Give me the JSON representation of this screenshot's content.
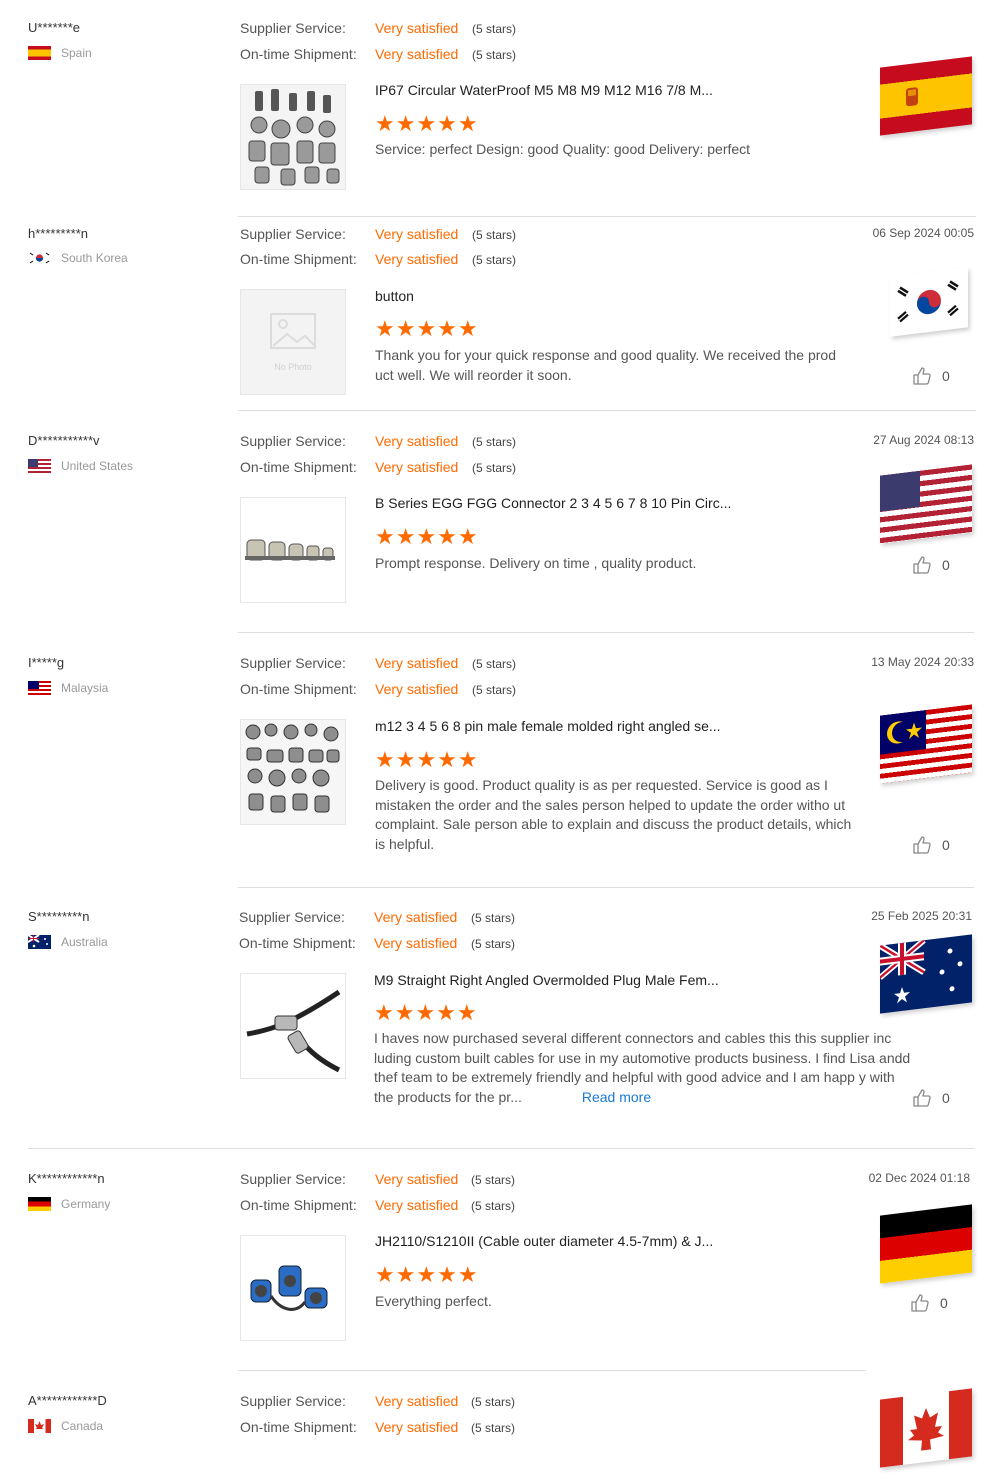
{
  "labels": {
    "supplier_service": "Supplier Service:",
    "ontime_shipment": "On-time Shipment:"
  },
  "colors": {
    "accent": "#ff6a00",
    "link": "#1a7ad0"
  },
  "reviews": [
    {
      "user": "U*******e",
      "country": "Spain",
      "date": "",
      "supplier_service": "Very satisfied",
      "supplier_stars": "(5 stars)",
      "shipment": "Very satisfied",
      "shipment_stars": "(5 stars)",
      "product_title": "IP67 Circular WaterProof M5 M8 M9 M12 M16 7/8 M...",
      "rating": 5,
      "content": "Service:   perfect Design:   good Quality:   good Delivery:   perfect",
      "likes": "",
      "flag": "spain"
    },
    {
      "user": "h*********n",
      "country": "South Korea",
      "date": "06 Sep 2024 00:05",
      "supplier_service": "Very satisfied",
      "supplier_stars": "(5 stars)",
      "shipment": "Very satisfied",
      "shipment_stars": "(5 stars)",
      "product_title": "button",
      "rating": 5,
      "content": "Thank you for your quick response and good quality. We received the prod uct well. We will reorder it soon.",
      "likes": "0",
      "flag": "korea",
      "placeholder_text": "No Photo"
    },
    {
      "user": "D***********v",
      "country": "United States",
      "date": "27 Aug 2024 08:13",
      "supplier_service": "Very satisfied",
      "supplier_stars": "(5 stars)",
      "shipment": "Very satisfied",
      "shipment_stars": "(5 stars)",
      "product_title": "B Series EGG FGG Connector 2 3 4 5 6 7 8 10 Pin Circ...",
      "rating": 5,
      "content": "Prompt response. Delivery on time , quality product.",
      "likes": "0",
      "flag": "usa"
    },
    {
      "user": "I*****g",
      "country": "Malaysia",
      "date": "13 May 2024 20:33",
      "supplier_service": "Very satisfied",
      "supplier_stars": "(5 stars)",
      "shipment": "Very satisfied",
      "shipment_stars": "(5 stars)",
      "product_title": "m12 3 4 5 6 8 pin male female molded right angled se...",
      "rating": 5,
      "content": "Delivery is good. Product quality is as per requested. Service is good as I mistaken the order and the sales person helped to update the order witho ut complaint. Sale person able to explain and discuss the product details, which is helpful.",
      "likes": "0",
      "flag": "malaysia"
    },
    {
      "user": "S*********n",
      "country": "Australia",
      "date": "25 Feb 2025 20:31",
      "supplier_service": "Very satisfied",
      "supplier_stars": "(5 stars)",
      "shipment": "Very satisfied",
      "shipment_stars": "(5 stars)",
      "product_title": "M9 Straight Right Angled Overmolded Plug Male Fem...",
      "rating": 5,
      "content": "I haves now purchased several different connectors and cables this this supplier inc luding custom built cables for use in my automotive products business.  I find Lisa andd thef team to be extremely friendly and helpful with good advice and I am happ y with the products for the pr...",
      "read_more": "Read more",
      "likes": "0",
      "flag": "australia"
    },
    {
      "user": "K************n",
      "country": "Germany",
      "date": "02 Dec 2024 01:18",
      "supplier_service": "Very satisfied",
      "supplier_stars": "(5 stars)",
      "shipment": "Very satisfied",
      "shipment_stars": "(5 stars)",
      "product_title": "JH2110/S1210II (Cable outer diameter 4.5-7mm) & J...",
      "rating": 5,
      "content": "Everything perfect.",
      "likes": "0",
      "flag": "germany"
    },
    {
      "user": "A************D",
      "country": "Canada",
      "date": "",
      "supplier_service": "Very satisfied",
      "supplier_stars": "(5 stars)",
      "shipment": "Very satisfied",
      "shipment_stars": "(5 stars)",
      "likes": "",
      "flag": "canada"
    }
  ]
}
